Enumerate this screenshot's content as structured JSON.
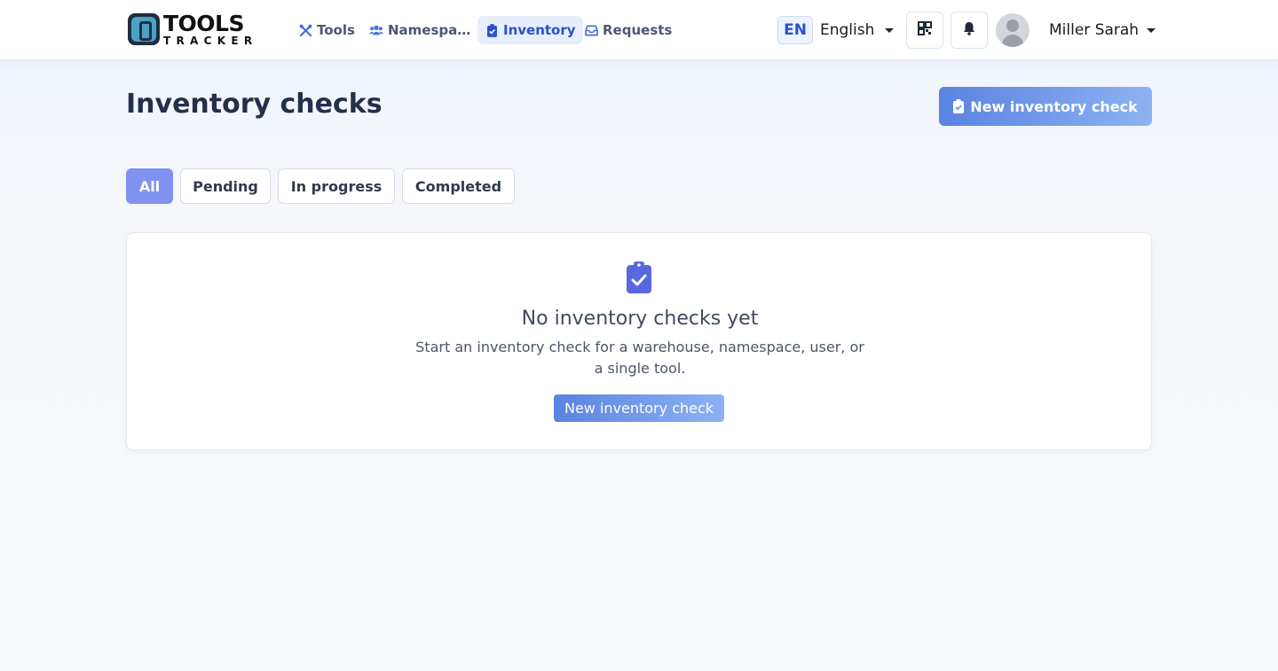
{
  "brand": {
    "name_top": "TOOLS",
    "name_bottom": "TRACKER"
  },
  "nav": {
    "items": [
      {
        "label": "Tools",
        "icon": "tools-icon"
      },
      {
        "label": "Namespa…",
        "icon": "users-icon"
      },
      {
        "label": "Inventory",
        "icon": "clipboard-check-icon",
        "active": true
      },
      {
        "label": "Requests",
        "icon": "inbox-icon"
      }
    ]
  },
  "header": {
    "language_code": "EN",
    "language_label": "English",
    "user_name": "Miller Sarah",
    "icons": [
      "qr-code-icon",
      "bell-icon",
      "avatar"
    ]
  },
  "page": {
    "title": "Inventory checks",
    "new_button_label": "New inventory check"
  },
  "filters": {
    "items": [
      {
        "label": "All",
        "active": true
      },
      {
        "label": "Pending"
      },
      {
        "label": "In progress"
      },
      {
        "label": "Completed"
      }
    ]
  },
  "empty_state": {
    "icon": "clipboard-check-icon",
    "title": "No inventory checks yet",
    "text": "Start an inventory check for a warehouse, namespace, user, or a single tool.",
    "button_label": "New inventory check"
  },
  "colors": {
    "accent": "#2a52c9",
    "filter_active": "#8092f0",
    "button_gradient_start": "#5a83e0",
    "button_gradient_end": "#8db2f3",
    "empty_icon": "#5b67e0"
  }
}
